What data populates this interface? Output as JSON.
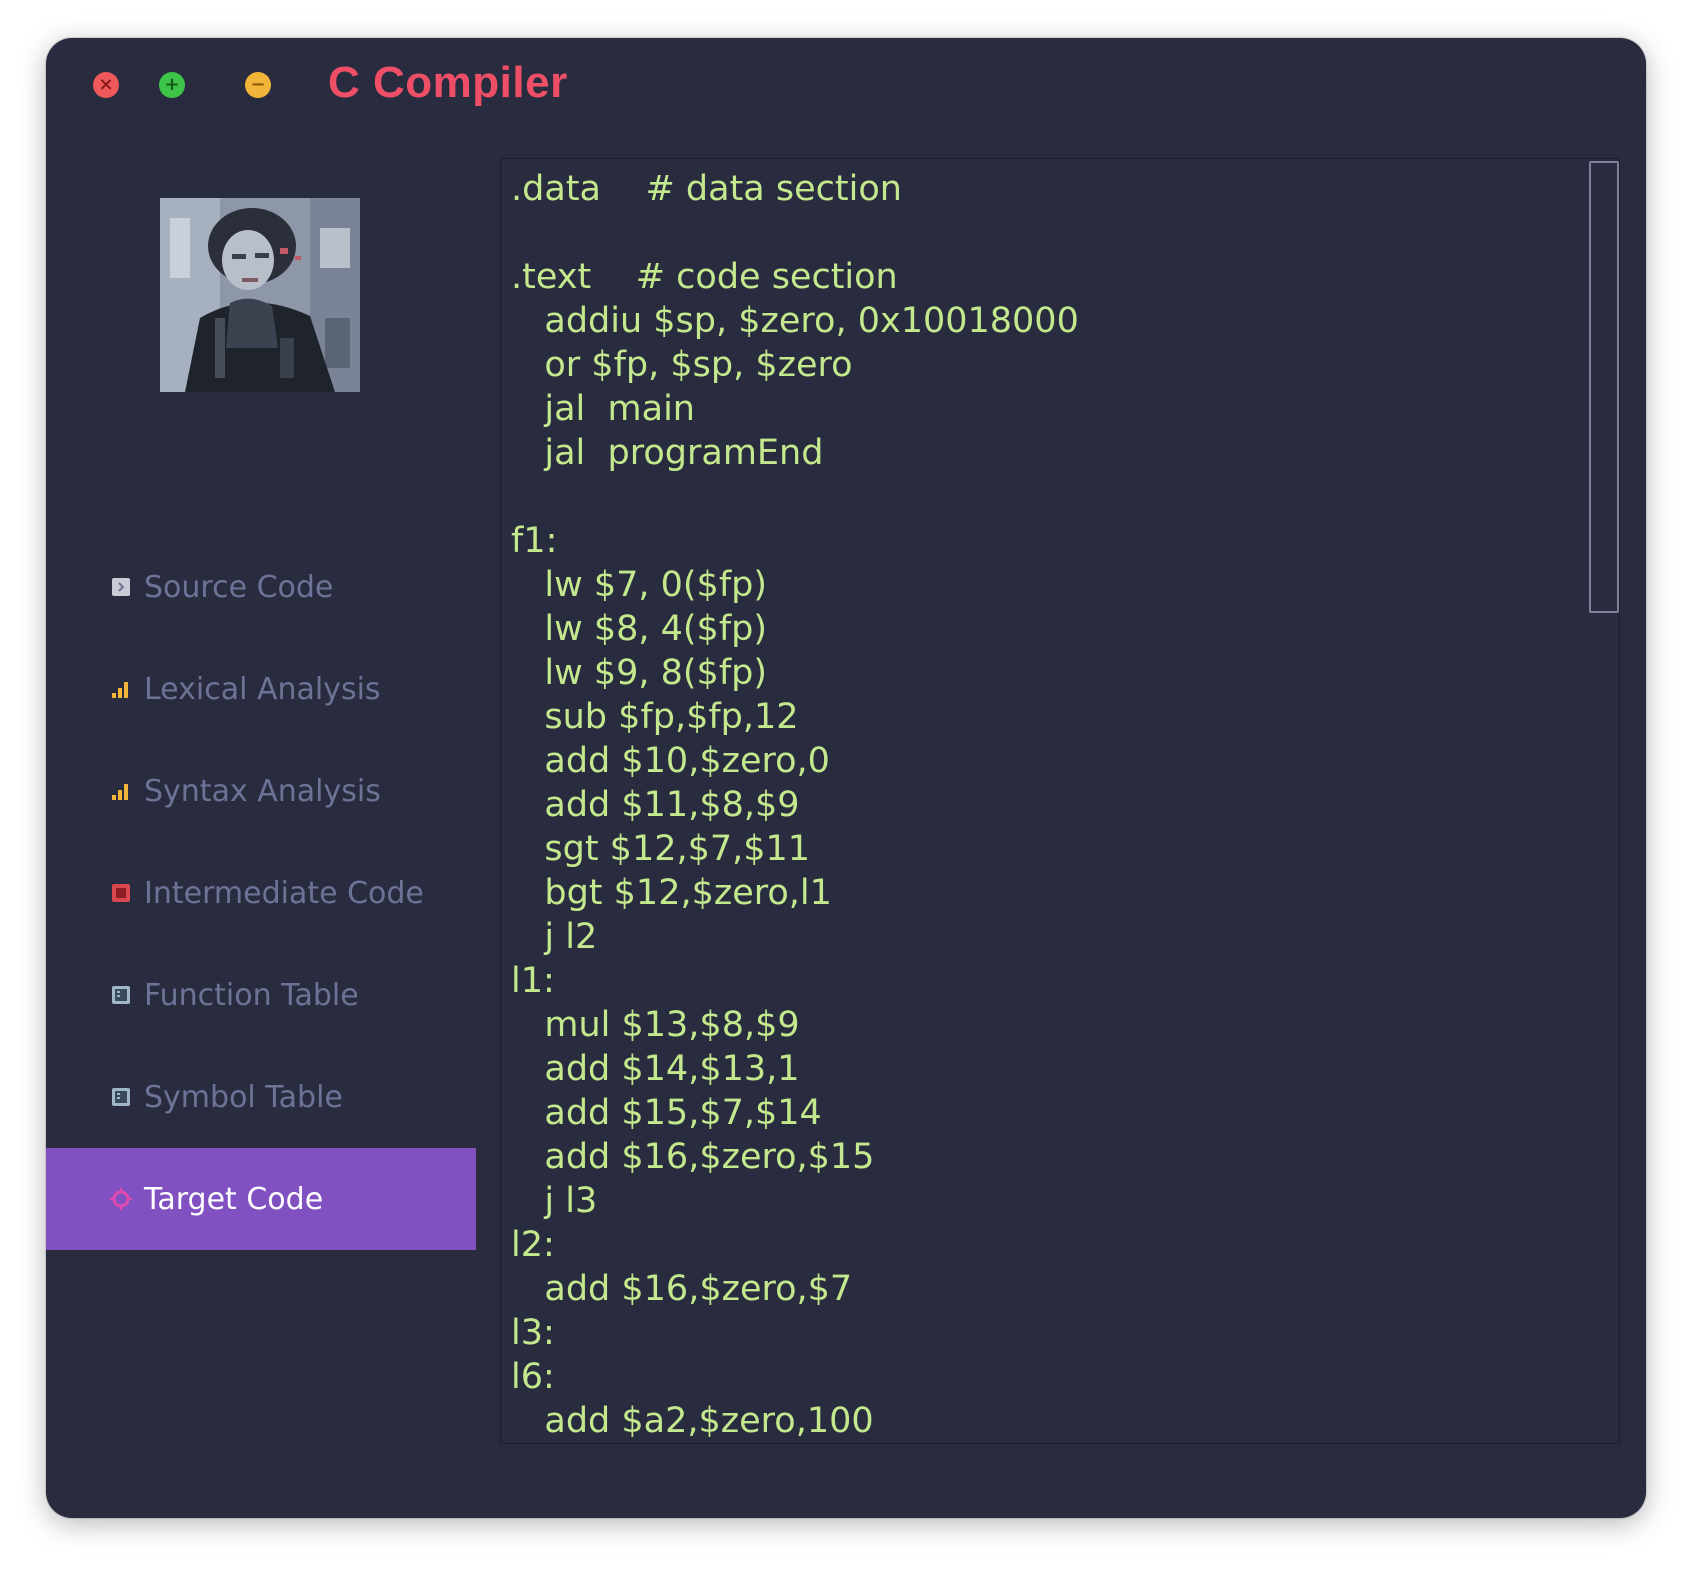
{
  "window": {
    "title": "C Compiler",
    "controls": {
      "close_icon": "close-icon",
      "maximize_icon": "plus-icon",
      "minimize_icon": "minus-icon"
    }
  },
  "sidebar": {
    "items": [
      {
        "label": "Source Code",
        "icon": "document-icon",
        "active": false
      },
      {
        "label": "Lexical Analysis",
        "icon": "bar-chart-icon",
        "active": false
      },
      {
        "label": "Syntax Analysis",
        "icon": "bar-chart-icon",
        "active": false
      },
      {
        "label": "Intermediate Code",
        "icon": "stop-square-icon",
        "active": false
      },
      {
        "label": "Function Table",
        "icon": "table-icon",
        "active": false
      },
      {
        "label": "Symbol Table",
        "icon": "table-icon",
        "active": false
      },
      {
        "label": "Target Code",
        "icon": "crosshair-icon",
        "active": true
      }
    ]
  },
  "editor": {
    "lines": [
      ".data    # data section",
      "",
      ".text    # code section",
      "   addiu $sp, $zero, 0x10018000",
      "   or $fp, $sp, $zero",
      "   jal  main",
      "   jal  programEnd",
      "",
      "f1:",
      "   lw $7, 0($fp)",
      "   lw $8, 4($fp)",
      "   lw $9, 8($fp)",
      "   sub $fp,$fp,12",
      "   add $10,$zero,0",
      "   add $11,$8,$9",
      "   sgt $12,$7,$11",
      "   bgt $12,$zero,l1",
      "   j l2",
      "l1:",
      "   mul $13,$8,$9",
      "   add $14,$13,1",
      "   add $15,$7,$14",
      "   add $16,$zero,$15",
      "   j l3",
      "l2:",
      "   add $16,$zero,$7",
      "l3:",
      "l6:",
      "   add $a2,$zero,100"
    ]
  },
  "colors": {
    "background": "#292c3e",
    "title": "#ee4f66",
    "code_text": "#c3e88d",
    "nav_text": "#6d7396",
    "active_bg": "#8150c1"
  }
}
